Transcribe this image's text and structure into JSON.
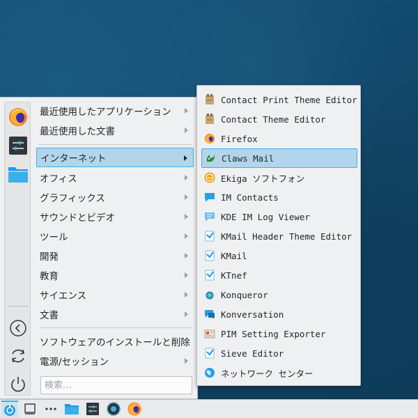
{
  "menu": {
    "categories": [
      {
        "label": "最近使用したアプリケーション"
      },
      {
        "label": "最近使用した文書"
      },
      {
        "label": "インターネット"
      },
      {
        "label": "オフィス"
      },
      {
        "label": "グラフィックス"
      },
      {
        "label": "サウンドとビデオ"
      },
      {
        "label": "ツール"
      },
      {
        "label": "開発"
      },
      {
        "label": "教育"
      },
      {
        "label": "サイエンス"
      },
      {
        "label": "文書"
      }
    ],
    "software_label": "ソフトウェアのインストールと削除",
    "power_label": "電源/セッション",
    "search_placeholder": "検索..."
  },
  "submenu": {
    "items": [
      {
        "label": "Contact Print Theme Editor"
      },
      {
        "label": "Contact Theme Editor"
      },
      {
        "label": "Firefox"
      },
      {
        "label": "Claws Mail"
      },
      {
        "label": "Ekiga ソフトフォン"
      },
      {
        "label": "IM Contacts"
      },
      {
        "label": "KDE IM Log Viewer"
      },
      {
        "label": "KMail Header Theme Editor"
      },
      {
        "label": "KMail"
      },
      {
        "label": "KTnef"
      },
      {
        "label": "Konqueror"
      },
      {
        "label": "Konversation"
      },
      {
        "label": "PIM Setting Exporter"
      },
      {
        "label": "Sieve Editor"
      },
      {
        "label": "ネットワーク センター"
      }
    ]
  },
  "colors": {
    "accent": "#3daee9",
    "highlight": "#b2d5eb"
  }
}
